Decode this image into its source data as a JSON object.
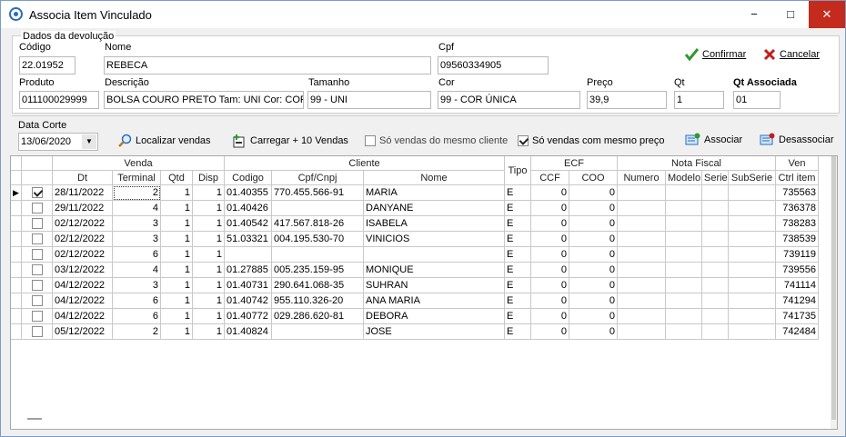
{
  "window": {
    "title": "Associa Item Vinculado"
  },
  "controls": {
    "minimize": "−",
    "maximize": "□",
    "close": "✕"
  },
  "devolucao": {
    "legend": "Dados da devolução",
    "codigo_label": "Código",
    "codigo": "22.01952",
    "nome_label": "Nome",
    "nome": "REBECA",
    "cpf_label": "Cpf",
    "cpf": "09560334905",
    "produto_label": "Produto",
    "produto": "011100029999",
    "descricao_label": "Descrição",
    "descricao": "BOLSA COURO PRETO Tam: UNI Cor: COR Ú",
    "tamanho_label": "Tamanho",
    "tamanho": "99 - UNI",
    "cor_label": "Cor",
    "cor": "99 - COR ÚNICA",
    "preco_label": "Preço",
    "preco": "39,9",
    "qt_label": "Qt",
    "qt": "1",
    "qt_associada_label": "Qt Associada",
    "qt_associada": "01"
  },
  "actions": {
    "confirmar": "Confirmar",
    "cancelar": "Cancelar",
    "localizar": "Localizar vendas",
    "carregar": "Carregar + 10 Vendas",
    "associar": "Associar",
    "desassociar": "Desassociar"
  },
  "filters": {
    "data_corte_label": "Data Corte",
    "data_corte": "13/06/2020",
    "mesmo_cliente": "Só vendas do mesmo cliente",
    "mesmo_cliente_checked": false,
    "mesmo_preco": "Só vendas com mesmo preço",
    "mesmo_preco_checked": true
  },
  "grid": {
    "groups": [
      "Venda",
      "Cliente",
      "ECF",
      "Nota Fiscal",
      "Ven"
    ],
    "columns": [
      "Dt",
      "Terminal",
      "Qtd",
      "Disp",
      "Codigo",
      "Cpf/Cnpj",
      "Nome",
      "Tipo",
      "CCF",
      "COO",
      "Numero",
      "Modelo",
      "Serie",
      "SubSerie",
      "Ctrl item"
    ],
    "rows": [
      {
        "checked": true,
        "dt": "28/11/2022",
        "terminal": "2",
        "qtd": "1",
        "disp": "1",
        "codigo": "01.40355",
        "cpf": "770.455.566-91",
        "nome": "MARIA",
        "tipo": "E",
        "ccf": "0",
        "coo": "0",
        "ctrl": "735563"
      },
      {
        "checked": false,
        "dt": "29/11/2022",
        "terminal": "4",
        "qtd": "1",
        "disp": "1",
        "codigo": "01.40426",
        "cpf": "",
        "nome": "DANYANE",
        "tipo": "E",
        "ccf": "0",
        "coo": "0",
        "ctrl": "736378"
      },
      {
        "checked": false,
        "dt": "02/12/2022",
        "terminal": "3",
        "qtd": "1",
        "disp": "1",
        "codigo": "01.40542",
        "cpf": "417.567.818-26",
        "nome": "ISABELA",
        "tipo": "E",
        "ccf": "0",
        "coo": "0",
        "ctrl": "738283"
      },
      {
        "checked": false,
        "dt": "02/12/2022",
        "terminal": "3",
        "qtd": "1",
        "disp": "1",
        "codigo": "51.03321",
        "cpf": "004.195.530-70",
        "nome": "VINICIOS",
        "tipo": "E",
        "ccf": "0",
        "coo": "0",
        "ctrl": "738539"
      },
      {
        "checked": false,
        "dt": "02/12/2022",
        "terminal": "6",
        "qtd": "1",
        "disp": "1",
        "codigo": "",
        "cpf": "",
        "nome": "",
        "tipo": "E",
        "ccf": "0",
        "coo": "0",
        "ctrl": "739119"
      },
      {
        "checked": false,
        "dt": "03/12/2022",
        "terminal": "4",
        "qtd": "1",
        "disp": "1",
        "codigo": "01.27885",
        "cpf": "005.235.159-95",
        "nome": "MONIQUE",
        "tipo": "E",
        "ccf": "0",
        "coo": "0",
        "ctrl": "739556"
      },
      {
        "checked": false,
        "dt": "04/12/2022",
        "terminal": "3",
        "qtd": "1",
        "disp": "1",
        "codigo": "01.40731",
        "cpf": "290.641.068-35",
        "nome": "SUHRAN",
        "tipo": "E",
        "ccf": "0",
        "coo": "0",
        "ctrl": "741114"
      },
      {
        "checked": false,
        "dt": "04/12/2022",
        "terminal": "6",
        "qtd": "1",
        "disp": "1",
        "codigo": "01.40742",
        "cpf": "955.110.326-20",
        "nome": "ANA MARIA",
        "tipo": "E",
        "ccf": "0",
        "coo": "0",
        "ctrl": "741294"
      },
      {
        "checked": false,
        "dt": "04/12/2022",
        "terminal": "6",
        "qtd": "1",
        "disp": "1",
        "codigo": "01.40772",
        "cpf": "029.286.620-81",
        "nome": "DEBORA",
        "tipo": "E",
        "ccf": "0",
        "coo": "0",
        "ctrl": "741735"
      },
      {
        "checked": false,
        "dt": "05/12/2022",
        "terminal": "2",
        "qtd": "1",
        "disp": "1",
        "codigo": "01.40824",
        "cpf": "",
        "nome": "JOSE",
        "tipo": "E",
        "ccf": "0",
        "coo": "0",
        "ctrl": "742484"
      }
    ]
  }
}
